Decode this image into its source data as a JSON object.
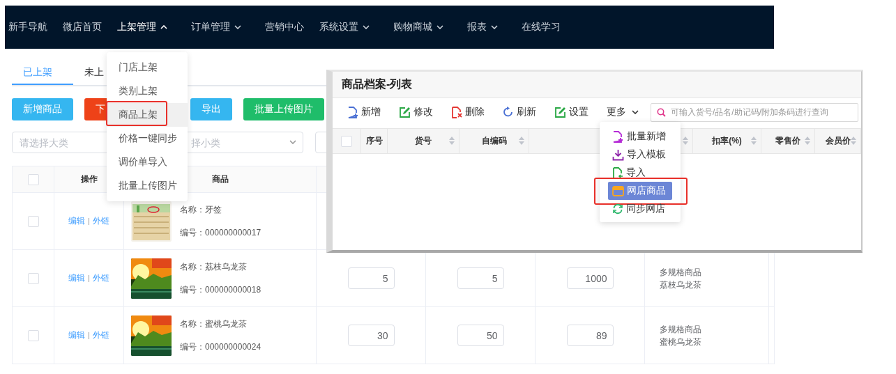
{
  "nav": {
    "items": [
      {
        "label": "新手导航",
        "dropdown": false,
        "expanded": false
      },
      {
        "label": "微店首页",
        "dropdown": false,
        "expanded": false
      },
      {
        "label": "上架管理",
        "dropdown": true,
        "expanded": true
      },
      {
        "label": "订单管理",
        "dropdown": true,
        "expanded": false
      },
      {
        "label": "营销中心",
        "dropdown": false,
        "expanded": false
      },
      {
        "label": "系统设置",
        "dropdown": true,
        "expanded": false
      },
      {
        "label": "购物商城",
        "dropdown": true,
        "expanded": false
      },
      {
        "label": "报表",
        "dropdown": true,
        "expanded": false
      },
      {
        "label": "在线学习",
        "dropdown": false,
        "expanded": false
      }
    ]
  },
  "nav_menu": {
    "items": [
      {
        "label": "门店上架",
        "selected": false,
        "highlighted": false
      },
      {
        "label": "类别上架",
        "selected": false,
        "highlighted": false
      },
      {
        "label": "商品上架",
        "selected": true,
        "highlighted": true
      },
      {
        "label": "价格一键同步",
        "selected": false,
        "highlighted": false
      },
      {
        "label": "调价单导入",
        "selected": false,
        "highlighted": false
      },
      {
        "label": "批量上传图片",
        "selected": false,
        "highlighted": false
      }
    ]
  },
  "tabs": [
    {
      "label": "已上架",
      "selected": true
    },
    {
      "label": "未上",
      "selected": false
    }
  ],
  "actions": [
    {
      "label": "新增商品",
      "color": "#35b6f0"
    },
    {
      "label": "下",
      "color": "#ee4218"
    },
    {
      "label": "导出",
      "color": "#35b6f0"
    },
    {
      "label": "批量上传图片",
      "color": "#1fbd6a"
    }
  ],
  "filters": [
    {
      "placeholder": "请选择大类"
    },
    {
      "placeholder": "择小类"
    }
  ],
  "table": {
    "header_checked": false,
    "columns": [
      {
        "label": "操作"
      },
      {
        "label": "商品"
      }
    ],
    "rows": [
      {
        "checked": false,
        "links": [
          "编辑",
          "外链"
        ],
        "name": "名称：牙签",
        "code": "编号：000000000017"
      },
      {
        "checked": false,
        "links": [
          "编辑",
          "外链"
        ],
        "name": "名称：荔枝乌龙茶",
        "code": "编号：000000000018",
        "inputs": [
          "5",
          "5",
          "1000"
        ],
        "spec": [
          "多规格商品",
          "荔枝乌龙茶"
        ]
      },
      {
        "checked": false,
        "links": [
          "编辑",
          "外链"
        ],
        "name": "名称：蜜桃乌龙茶",
        "code": "编号：000000000024",
        "inputs": [
          "30",
          "50",
          "89"
        ],
        "spec": [
          "多规格商品",
          "蜜桃乌龙茶"
        ]
      }
    ]
  },
  "window": {
    "title": "商品档案-列表",
    "toolbar": [
      {
        "label": "新增",
        "kind": "new"
      },
      {
        "label": "修改",
        "kind": "edit"
      },
      {
        "label": "删除",
        "kind": "delete"
      },
      {
        "label": "刷新",
        "kind": "refresh"
      },
      {
        "label": "设置",
        "kind": "settings"
      },
      {
        "label": "更多",
        "kind": "more",
        "expanded": true
      }
    ],
    "search": {
      "placeholder": "可输入货号/品名/助记码/附加条码进行查询"
    },
    "header_checked": false,
    "columns": [
      {
        "label": "序号",
        "sortable": false
      },
      {
        "label": "货号",
        "sortable": true
      },
      {
        "label": "自编码",
        "sortable": true
      },
      {
        "sortable": true
      },
      {
        "label": "扣率(%)",
        "sortable": true
      },
      {
        "label": "零售价",
        "sortable": true
      },
      {
        "label": "会员价",
        "sortable": true
      }
    ],
    "more_menu": [
      {
        "label": "批量新增",
        "kind": "batch-add",
        "selected": false,
        "highlighted": false
      },
      {
        "label": "导入模板",
        "kind": "template",
        "selected": false,
        "highlighted": false
      },
      {
        "label": "导入",
        "kind": "import",
        "selected": false,
        "highlighted": false
      },
      {
        "label": "网店商品",
        "kind": "shop",
        "selected": true,
        "highlighted": true
      },
      {
        "label": "同步网店",
        "kind": "sync",
        "selected": false,
        "highlighted": false
      }
    ]
  }
}
